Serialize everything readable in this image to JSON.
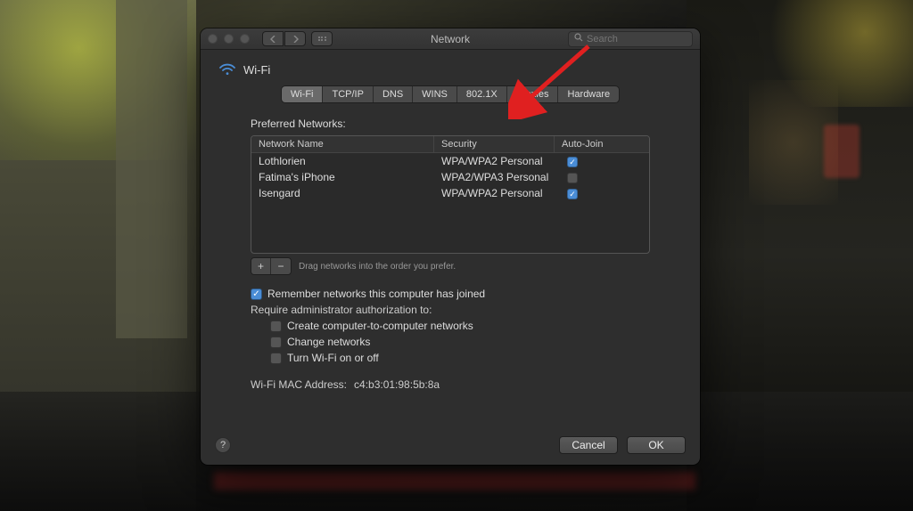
{
  "titlebar": {
    "title": "Network",
    "search_placeholder": "Search"
  },
  "header": {
    "wifi_label": "Wi-Fi"
  },
  "tabs": [
    {
      "label": "Wi-Fi",
      "active": true
    },
    {
      "label": "TCP/IP"
    },
    {
      "label": "DNS"
    },
    {
      "label": "WINS"
    },
    {
      "label": "802.1X"
    },
    {
      "label": "Proxies"
    },
    {
      "label": "Hardware"
    }
  ],
  "preferred_networks": {
    "label": "Preferred Networks:",
    "columns": {
      "name": "Network Name",
      "security": "Security",
      "autojoin": "Auto-Join"
    },
    "rows": [
      {
        "name": "Lothlorien",
        "security": "WPA/WPA2 Personal",
        "autojoin": true
      },
      {
        "name": "Fatima's iPhone",
        "security": "WPA2/WPA3 Personal",
        "autojoin": false
      },
      {
        "name": "Isengard",
        "security": "WPA/WPA2 Personal",
        "autojoin": true
      }
    ],
    "drag_hint": "Drag networks into the order you prefer."
  },
  "options": {
    "remember_label": "Remember networks this computer has joined",
    "remember_checked": true,
    "require_label": "Require administrator authorization to:",
    "sub": [
      {
        "label": "Create computer-to-computer networks",
        "checked": false
      },
      {
        "label": "Change networks",
        "checked": false
      },
      {
        "label": "Turn Wi-Fi on or off",
        "checked": false
      }
    ]
  },
  "mac": {
    "label": "Wi-Fi MAC Address:",
    "value": "c4:b3:01:98:5b:8a"
  },
  "buttons": {
    "cancel": "Cancel",
    "ok": "OK",
    "add": "+",
    "remove": "−"
  }
}
